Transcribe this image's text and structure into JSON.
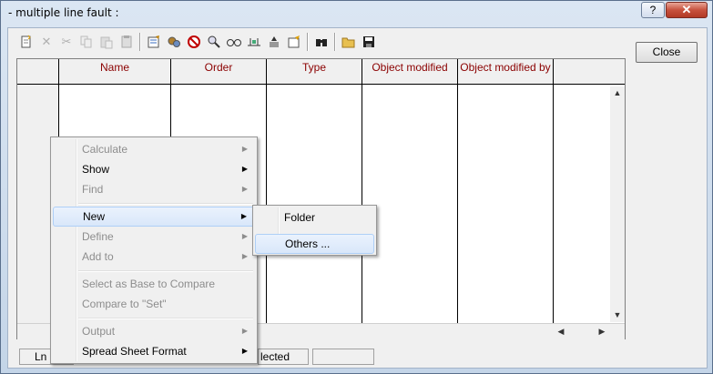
{
  "window": {
    "title": "- multiple line fault :",
    "help_label": "?",
    "close_glyph": "✕"
  },
  "toolbar": {
    "icons": [
      "new-icon",
      "delete-icon",
      "cut-icon",
      "copy-icon",
      "paste-icon",
      "paste-special-icon",
      "edit-icon",
      "calculate-icon",
      "disable-icon",
      "find-icon",
      "glasses-icon",
      "connect-icon",
      "mark-icon",
      "edit-object-icon",
      "binoculars-icon",
      "open-folder-icon",
      "save-icon"
    ]
  },
  "close_button": "Close",
  "table": {
    "columns": [
      "Name",
      "Order",
      "Type",
      "Object modified",
      "Object modified by"
    ]
  },
  "status": {
    "left": "Ln",
    "middle": "lected"
  },
  "context_menu": {
    "items": [
      {
        "label": "Calculate",
        "enabled": false,
        "submenu": true
      },
      {
        "label": "Show",
        "enabled": true,
        "submenu": true
      },
      {
        "label": "Find",
        "enabled": false,
        "submenu": true
      },
      {
        "label": "New",
        "enabled": true,
        "submenu": true,
        "highlighted": true
      },
      {
        "label": "Define",
        "enabled": false,
        "submenu": true
      },
      {
        "label": "Add to",
        "enabled": false,
        "submenu": true
      },
      {
        "label": "Select as Base to Compare",
        "enabled": false,
        "submenu": false
      },
      {
        "label": "Compare to \"Set\"",
        "enabled": false,
        "submenu": false
      },
      {
        "label": "Output",
        "enabled": false,
        "submenu": true
      },
      {
        "label": "Spread Sheet Format",
        "enabled": true,
        "submenu": true
      }
    ]
  },
  "submenu": {
    "items": [
      {
        "label": "Folder"
      },
      {
        "label": "Others ...",
        "highlighted": true
      }
    ]
  }
}
